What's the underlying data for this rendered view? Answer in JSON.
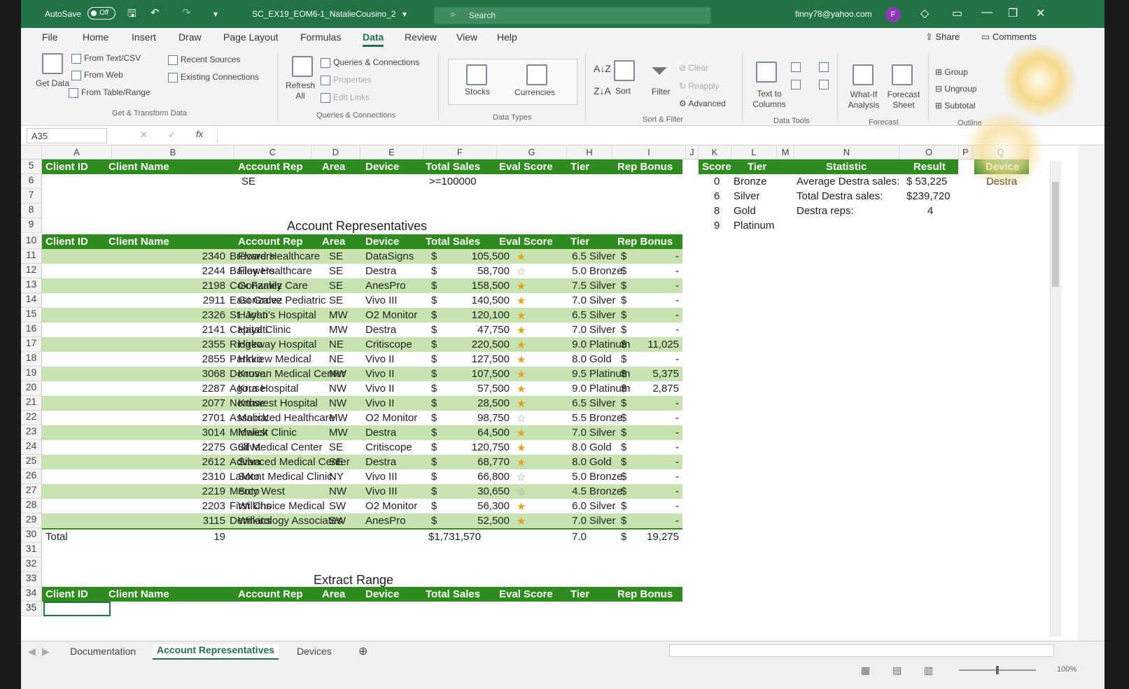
{
  "titlebar": {
    "autosave_label": "AutoSave",
    "autosave_state": "Off",
    "filename": "SC_EX19_EOM6-1_NatalieCousino_2",
    "search_placeholder": "Search",
    "account": "finny78@yahoo.com",
    "avatar_initial": "F"
  },
  "menu": [
    "File",
    "Home",
    "Insert",
    "Draw",
    "Page Layout",
    "Formulas",
    "Data",
    "Review",
    "View",
    "Help"
  ],
  "menu_active": "Data",
  "share_label": "Share",
  "comments_label": "Comments",
  "ribbon": {
    "get_data": "Get Data",
    "from_text_csv": "From Text/CSV",
    "from_web": "From Web",
    "from_table": "From Table/Range",
    "recent_sources": "Recent Sources",
    "existing_connections": "Existing Connections",
    "group_get": "Get & Transform Data",
    "refresh_all": "Refresh All",
    "queries_connections": "Queries & Connections",
    "properties": "Properties",
    "edit_links": "Edit Links",
    "group_queries": "Queries & Connections",
    "stocks": "Stocks",
    "currencies": "Currencies",
    "group_types": "Data Types",
    "sort": "Sort",
    "filter": "Filter",
    "clear": "Clear",
    "reapply": "Reapply",
    "advanced": "Advanced",
    "group_sort": "Sort & Filter",
    "text_to_columns": "Text to Columns",
    "group_tools": "Data Tools",
    "what_if": "What-If Analysis",
    "forecast_sheet": "Forecast Sheet",
    "group_forecast": "Forecast",
    "group": "Group",
    "ungroup": "Ungroup",
    "subtotal": "Subtotal",
    "group_outline": "Outline"
  },
  "formula_bar": {
    "namebox": "A35",
    "fx": "fx",
    "content": ""
  },
  "columns": [
    "A",
    "B",
    "C",
    "D",
    "E",
    "F",
    "G",
    "H",
    "I",
    "J",
    "K",
    "L",
    "M",
    "N",
    "O",
    "P",
    "Q"
  ],
  "criteria": {
    "headers": [
      "Client ID",
      "Client Name",
      "Account Rep",
      "Area",
      "Device",
      "Total Sales",
      "Eval Score",
      "Tier",
      "Rep Bonus"
    ],
    "area": "SE",
    "total_sales": ">=100000"
  },
  "section_title": "Account Representatives",
  "table_headers": [
    "Client ID",
    "Client Name",
    "Account Rep",
    "Area",
    "Device",
    "Total Sales",
    "Eval Score",
    "Tier",
    "Rep Bonus"
  ],
  "rows": [
    {
      "r": "11",
      "id": "2340",
      "name": "Brevard Healthcare",
      "rep": "Flowers",
      "area": "SE",
      "device": "DataSigns",
      "sales": "105,500",
      "score": "6.5",
      "tier": "Silver",
      "bonus": "-",
      "star": "half"
    },
    {
      "r": "12",
      "id": "2244",
      "name": "Bailey Healthcare",
      "rep": "Flowers",
      "area": "SE",
      "device": "Destra",
      "sales": "58,700",
      "score": "5.0",
      "tier": "Bronze",
      "bonus": "-",
      "star": "empty"
    },
    {
      "r": "13",
      "id": "2198",
      "name": "Cox Family Care",
      "rep": "Gonzalez",
      "area": "SE",
      "device": "AnesPro",
      "sales": "158,500",
      "score": "7.5",
      "tier": "Silver",
      "bonus": "-",
      "star": "half"
    },
    {
      "r": "14",
      "id": "2911",
      "name": "East Grove Pediatric",
      "rep": "Gonzalez",
      "area": "SE",
      "device": "Vivo III",
      "sales": "140,500",
      "score": "7.0",
      "tier": "Silver",
      "bonus": "-",
      "star": "half"
    },
    {
      "r": "15",
      "id": "2326",
      "name": "St. John's Hospital",
      "rep": "Hayati",
      "area": "MW",
      "device": "O2 Monitor",
      "sales": "120,100",
      "score": "6.5",
      "tier": "Silver",
      "bonus": "-",
      "star": "half"
    },
    {
      "r": "16",
      "id": "2141",
      "name": "Capital Clinic",
      "rep": "Hayati",
      "area": "MW",
      "device": "Destra",
      "sales": "47,750",
      "score": "7.0",
      "tier": "Silver",
      "bonus": "-",
      "star": "half"
    },
    {
      "r": "17",
      "id": "2355",
      "name": "Ridgeway Hospital",
      "rep": "Hirko",
      "area": "NE",
      "device": "Critiscope",
      "sales": "220,500",
      "score": "9.0",
      "tier": "Platinum",
      "bonus": "11,025",
      "star": "full"
    },
    {
      "r": "18",
      "id": "2855",
      "name": "Parkview Medical",
      "rep": "Hirko",
      "area": "NE",
      "device": "Vivo II",
      "sales": "127,500",
      "score": "8.0",
      "tier": "Gold",
      "bonus": "-",
      "star": "full"
    },
    {
      "r": "19",
      "id": "3068",
      "name": "Donovan Medical Center",
      "rep": "Kruse",
      "area": "NW",
      "device": "Vivo II",
      "sales": "107,500",
      "score": "9.5",
      "tier": "Platinum",
      "bonus": "5,375",
      "star": "full"
    },
    {
      "r": "20",
      "id": "2287",
      "name": "Agora Hospital",
      "rep": "Kruse",
      "area": "NW",
      "device": "Vivo II",
      "sales": "57,500",
      "score": "9.0",
      "tier": "Platinum",
      "bonus": "2,875",
      "star": "full"
    },
    {
      "r": "21",
      "id": "2077",
      "name": "Northwest Hospital",
      "rep": "Kruse",
      "area": "NW",
      "device": "Vivo II",
      "sales": "28,500",
      "score": "6.5",
      "tier": "Silver",
      "bonus": "-",
      "star": "half"
    },
    {
      "r": "22",
      "id": "2701",
      "name": "Associated Healthcare",
      "rep": "Malick",
      "area": "MW",
      "device": "O2 Monitor",
      "sales": "98,750",
      "score": "5.5",
      "tier": "Bronze",
      "bonus": "-",
      "star": "empty"
    },
    {
      "r": "23",
      "id": "3014",
      "name": "Midwest Clinic",
      "rep": "Malick",
      "area": "MW",
      "device": "Destra",
      "sales": "64,500",
      "score": "7.0",
      "tier": "Silver",
      "bonus": "-",
      "star": "half"
    },
    {
      "r": "24",
      "id": "2275",
      "name": "Gulf Medical Center",
      "rep": "Silva",
      "area": "SE",
      "device": "Critiscope",
      "sales": "120,750",
      "score": "8.0",
      "tier": "Gold",
      "bonus": "-",
      "star": "full"
    },
    {
      "r": "25",
      "id": "2612",
      "name": "Advanced Medical Center",
      "rep": "Silva",
      "area": "SE",
      "device": "Destra",
      "sales": "68,770",
      "score": "8.0",
      "tier": "Gold",
      "bonus": "-",
      "star": "full"
    },
    {
      "r": "26",
      "id": "2310",
      "name": "LaMont Medical Clinic",
      "rep": "Soto",
      "area": "NY",
      "device": "Vivo III",
      "sales": "66,800",
      "score": "5.0",
      "tier": "Bronze",
      "bonus": "-",
      "star": "empty"
    },
    {
      "r": "27",
      "id": "2219",
      "name": "Mercy West",
      "rep": "Soto",
      "area": "NW",
      "device": "Vivo III",
      "sales": "30,650",
      "score": "4.5",
      "tier": "Bronze",
      "bonus": "-",
      "star": "empty"
    },
    {
      "r": "28",
      "id": "2203",
      "name": "First Choice Medical",
      "rep": "Wilkins",
      "area": "SW",
      "device": "O2 Monitor",
      "sales": "56,300",
      "score": "6.0",
      "tier": "Silver",
      "bonus": "-",
      "star": "half"
    },
    {
      "r": "29",
      "id": "3115",
      "name": "Dermatology Associates",
      "rep": "Wilkins",
      "area": "SW",
      "device": "AnesPro",
      "sales": "52,500",
      "score": "7.0",
      "tier": "Silver",
      "bonus": "-",
      "star": "half"
    }
  ],
  "total_row": {
    "label": "Total",
    "count": "19",
    "sales": "$1,731,570",
    "score": "7.0",
    "bonus": "19,275"
  },
  "currency_symbol": "$",
  "extract_title": "Extract Range",
  "tier_table": {
    "headers": [
      "Score",
      "Tier"
    ],
    "rows": [
      [
        "0",
        "Bronze"
      ],
      [
        "6",
        "Silver"
      ],
      [
        "8",
        "Gold"
      ],
      [
        "9",
        "Platinum"
      ]
    ]
  },
  "stat_table": {
    "headers": [
      "Statistic",
      "Result"
    ],
    "rows": [
      [
        "Average Destra sales:",
        "$  53,225"
      ],
      [
        "Total Destra sales:",
        "$239,720"
      ],
      [
        "Destra reps:",
        "4"
      ]
    ]
  },
  "device_table": {
    "header": "Device",
    "value": "Destra"
  },
  "sheet_tabs": [
    "Documentation",
    "Account Representatives",
    "Devices"
  ],
  "active_tab": "Account Representatives",
  "zoom": "100%",
  "colors": {
    "header_green": "#2e8b1e",
    "band_green": "#c6e3b0",
    "title_green": "#217346"
  }
}
